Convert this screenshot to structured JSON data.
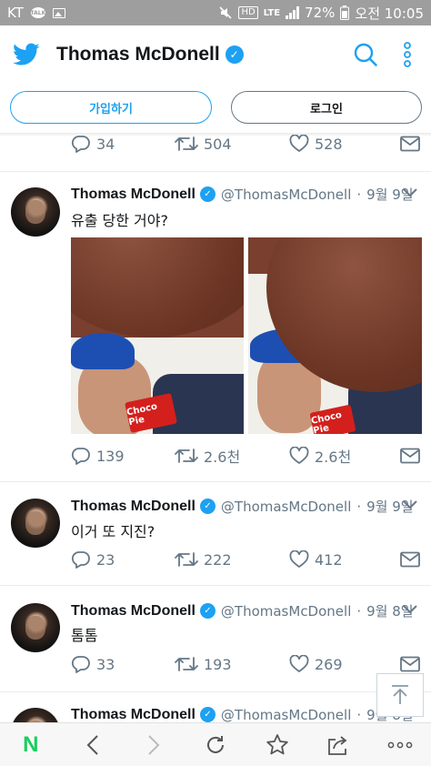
{
  "status_bar": {
    "carrier": "KT",
    "talk_badge": "TALK",
    "hd_label": "HD",
    "lte_label": "LTE",
    "battery": "72%",
    "time": "오전 10:05"
  },
  "header": {
    "title": "Thomas McDonell",
    "verified": "✓"
  },
  "auth": {
    "signup_label": "가입하기",
    "login_label": "로그인"
  },
  "tweets": [
    {
      "name": "",
      "handle": "",
      "date": "",
      "text": "",
      "replies": "34",
      "retweets": "504",
      "likes": "528"
    },
    {
      "name": "Thomas McDonell",
      "handle": "@ThomasMcDonell",
      "date": "9월 9일",
      "text": "유출 당한 거야?",
      "photo_caption": "Choco Pie",
      "replies": "139",
      "retweets": "2.6천",
      "likes": "2.6천"
    },
    {
      "name": "Thomas McDonell",
      "handle": "@ThomasMcDonell",
      "date": "9월 9일",
      "text": "이거 또 지진?",
      "replies": "23",
      "retweets": "222",
      "likes": "412"
    },
    {
      "name": "Thomas McDonell",
      "handle": "@ThomasMcDonell",
      "date": "9월 8일",
      "text": "톰톰",
      "replies": "33",
      "retweets": "193",
      "likes": "269"
    },
    {
      "name": "Thomas McDonell",
      "handle": "@ThomasMcDonell",
      "date": "9월 8일"
    }
  ],
  "bottom_nav": {
    "logo": "N"
  },
  "colors": {
    "accent": "#1da1f2",
    "muted": "#657786",
    "naver_green": "#19ce60"
  }
}
